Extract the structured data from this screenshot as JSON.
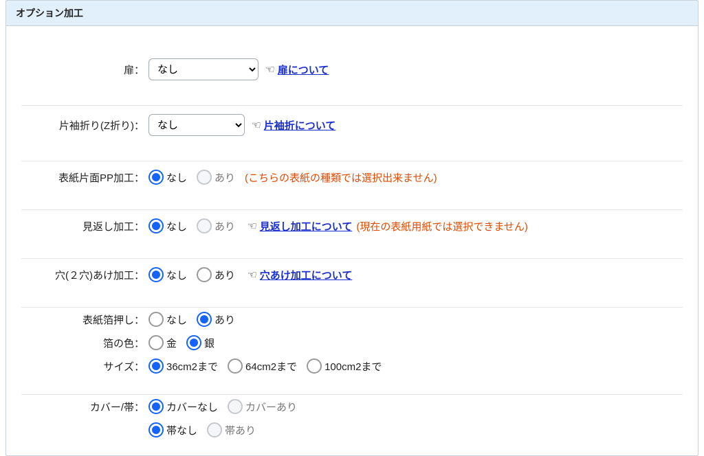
{
  "header": "オプション加工",
  "rows": {
    "tobira": {
      "label": "扉：",
      "select": "なし",
      "link": "扉について"
    },
    "katasode": {
      "label": "片袖折り(Z折り)：",
      "select": "なし",
      "link": "片袖折について"
    },
    "pp": {
      "label": "表紙片面PP加工：",
      "opt_none": "なし",
      "opt_yes": "あり",
      "warn": "(こちらの表紙の種類では選択出来ません)"
    },
    "mikaeshi": {
      "label": "見返し加工：",
      "opt_none": "なし",
      "opt_yes": "あり",
      "link": "見返し加工について",
      "warn": "(現在の表紙用紙では選択できません)"
    },
    "ana": {
      "label": "穴(２穴)あけ加工：",
      "opt_none": "なし",
      "opt_yes": "あり",
      "link": "穴あけ加工について"
    },
    "haku": {
      "label": "表紙箔押し：",
      "opt_none": "なし",
      "opt_yes": "あり"
    },
    "hakuColor": {
      "label": "箔の色：",
      "gold": "金",
      "silver": "銀"
    },
    "size": {
      "label": "サイズ：",
      "s1": "36cm2まで",
      "s2": "64cm2まで",
      "s3": "100cm2まで"
    },
    "cover": {
      "label": "カバー/帯：",
      "cover_none": "カバーなし",
      "cover_yes": "カバーあり",
      "obi_none": "帯なし",
      "obi_yes": "帯あり"
    }
  }
}
